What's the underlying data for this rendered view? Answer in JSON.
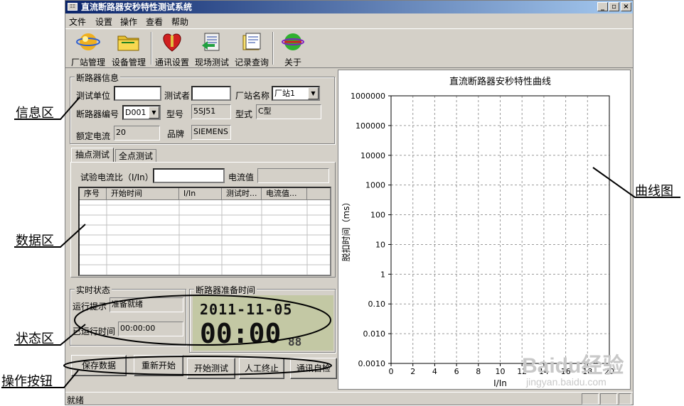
{
  "window": {
    "title": "直流断路器安秒特性测试系统",
    "controls": [
      "_",
      "▫",
      "×"
    ]
  },
  "menu": [
    "文件",
    "设置",
    "操作",
    "查看",
    "帮助"
  ],
  "toolbar": [
    {
      "label": "厂站管理",
      "icon": "factory-globe-icon"
    },
    {
      "label": "设备管理",
      "icon": "folder-icon"
    },
    {
      "label": "通讯设置",
      "icon": "heart-connector-icon"
    },
    {
      "label": "现场测试",
      "icon": "document-arrow-icon"
    },
    {
      "label": "记录查询",
      "icon": "records-icon"
    },
    {
      "label": "关于",
      "icon": "about-globe-icon"
    }
  ],
  "info": {
    "group_title": "断路器信息",
    "unit_label": "测试单位",
    "unit_value": "",
    "tester_label": "测试者",
    "tester_value": "",
    "station_label": "厂站名称",
    "station_value": "厂站1",
    "breaker_no_label": "断路器编号",
    "breaker_no_value": "D001",
    "model_label": "型号",
    "model_value": "5SJ51",
    "type_label": "型式",
    "type_value": "C型",
    "rated_label": "额定电流",
    "rated_value": "20",
    "brand_label": "品牌",
    "brand_value": "SIEMENS"
  },
  "tabs": [
    "抽点测试",
    "全点测试"
  ],
  "test": {
    "ratio_label": "试验电流比（I/In）",
    "ratio_value": "",
    "current_label": "电流值",
    "current_value": "",
    "columns": [
      "序号",
      "开始时间",
      "I/In",
      "测试时...",
      "电流值..."
    ]
  },
  "realtime": {
    "group_title": "实时状态",
    "hint_label": "运行提示",
    "hint_value": "准备就绪",
    "elapsed_label": "已运行时间",
    "elapsed_value": "00:00:00"
  },
  "ready": {
    "group_title": "断路器准备时间",
    "date": "2011-11-05",
    "time": "00:00",
    "small": "88"
  },
  "buttons": [
    "保存数据",
    "重新开始",
    "开始测试",
    "人工终止",
    "通讯自检"
  ],
  "status": {
    "text": "就绪"
  },
  "annotations": [
    "信息区",
    "数据区",
    "状态区",
    "操作按钮",
    "曲线图"
  ],
  "watermark": {
    "text": "Baidu经验",
    "sub": "jingyan.baidu.com"
  },
  "chart_data": {
    "type": "line",
    "title": "直流断路器安秒特性曲线",
    "xlabel": "I/In",
    "ylabel": "脱扣时间（ms）",
    "xlim": [
      0,
      20
    ],
    "x_ticks": [
      "0",
      "2",
      "4",
      "6",
      "8",
      "10",
      "12",
      "14",
      "16",
      "18",
      "20"
    ],
    "y_scale": "log",
    "ylim": [
      0.001,
      1000000
    ],
    "y_ticks": [
      "1000000",
      "100000",
      "10000",
      "1000",
      "100",
      "10",
      "1",
      "0.10",
      "0.010",
      "0.0010"
    ],
    "grid": true,
    "series": []
  }
}
